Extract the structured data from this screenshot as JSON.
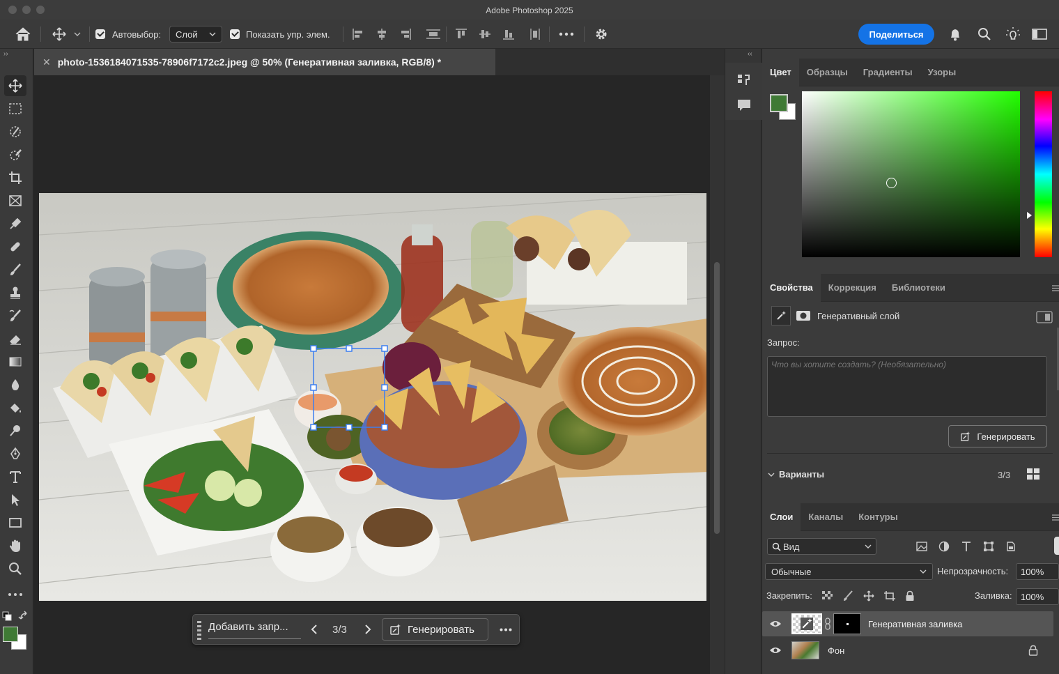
{
  "app": {
    "title": "Adobe Photoshop 2025"
  },
  "options_bar": {
    "autoselect_label": "Автовыбор:",
    "autoselect_value": "Слой",
    "show_transform_label": "Показать упр. элем.",
    "share_label": "Поделиться"
  },
  "document": {
    "tab_title": "photo-1536184071535-78906f7172c2.jpeg @ 50% (Генеративная заливка, RGB/8) *"
  },
  "task_bar": {
    "prompt_placeholder": "Добавить запр...",
    "counter": "3/3",
    "generate_label": "Генерировать"
  },
  "color_panel": {
    "tabs": [
      "Цвет",
      "Образцы",
      "Градиенты",
      "Узоры"
    ],
    "active_tab": "Цвет",
    "foreground_color": "#3f7a35",
    "background_color": "#ffffff",
    "hue_color": "#22ff00"
  },
  "properties_panel": {
    "tabs": [
      "Свойства",
      "Коррекция",
      "Библиотеки"
    ],
    "active_tab": "Свойства",
    "layer_type_label": "Генеративный слой",
    "prompt_label": "Запрос:",
    "prompt_placeholder": "Что вы хотите создать? (Необязательно)",
    "generate_label": "Генерировать",
    "variants_label": "Варианты",
    "variants_count": "3/3"
  },
  "layers_panel": {
    "tabs": [
      "Слои",
      "Каналы",
      "Контуры"
    ],
    "active_tab": "Слои",
    "filter_label": "Вид",
    "blend_mode": "Обычные",
    "opacity_label": "Непрозрачность:",
    "opacity_value": "100%",
    "lock_label": "Закрепить:",
    "fill_label": "Заливка:",
    "fill_value": "100%",
    "layers": [
      {
        "name": "Генеративная заливка",
        "selected": true
      },
      {
        "name": "Фон",
        "selected": false,
        "locked": true
      }
    ]
  },
  "colors": {
    "accent": "#1473e6",
    "panel": "#3b3b3b",
    "selection_handle": "#3d7ff0"
  }
}
